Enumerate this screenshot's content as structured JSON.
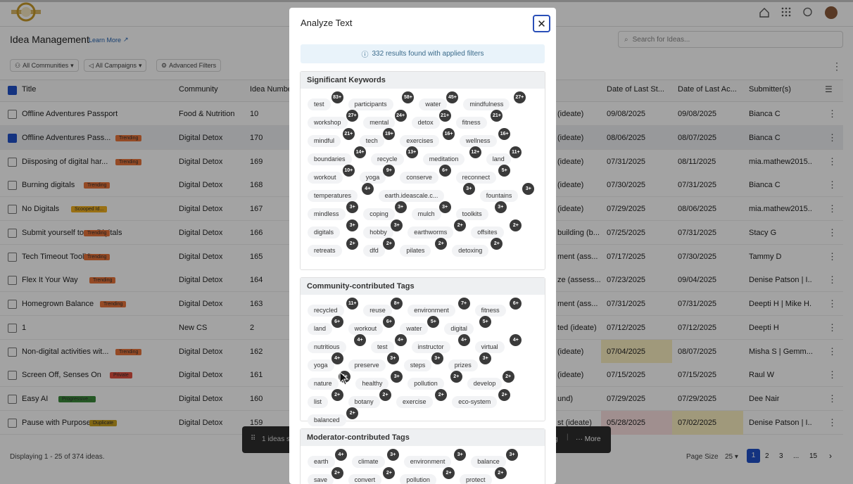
{
  "app": {
    "page_title": "Idea Management",
    "learn_more": "Learn More",
    "search_placeholder": "Search for Ideas..."
  },
  "filters": {
    "communities": "All Communities",
    "campaigns": "All Campaigns",
    "advanced": "Advanced Filters"
  },
  "columns": [
    "Title",
    "Community",
    "Idea Number",
    "Date of Last St...",
    "Date of Last Ac...",
    "Submitter(s)"
  ],
  "rows": [
    {
      "title": "Offline Adventures Passport",
      "community": "Food & Nutrition",
      "num": "10",
      "stage": "(ideate)",
      "d1": "09/08/2025",
      "d2": "09/08/2025",
      "sub": "Bianca C",
      "badge": "",
      "checked": false
    },
    {
      "title": "Offline Adventures Pass...",
      "community": "Digital Detox",
      "num": "170",
      "stage": "(ideate)",
      "d1": "08/06/2025",
      "d2": "08/07/2025",
      "sub": "Bianca C",
      "badge": "Trending",
      "checked": true
    },
    {
      "title": "Diisposing of digital har...",
      "community": "Digital Detox",
      "num": "169",
      "stage": "(ideate)",
      "d1": "07/31/2025",
      "d2": "08/11/2025",
      "sub": "mia.mathew2015...",
      "badge": "Trending",
      "checked": false
    },
    {
      "title": "Burning digitals",
      "community": "Digital Detox",
      "num": "168",
      "stage": "(ideate)",
      "d1": "07/30/2025",
      "d2": "07/31/2025",
      "sub": "Bianca C",
      "badge": "Trending",
      "checked": false
    },
    {
      "title": "No Digitals",
      "community": "Digital Detox",
      "num": "167",
      "stage": "(ideate)",
      "d1": "07/29/2025",
      "d2": "08/06/2025",
      "sub": "mia.mathew2015...",
      "badge": "Scooped Id...",
      "checked": false
    },
    {
      "title": "Submit yourself to no Digitals",
      "community": "Digital Detox",
      "num": "166",
      "stage": "building (b...",
      "d1": "07/25/2025",
      "d2": "07/31/2025",
      "sub": "Stacy G",
      "badge": "Trending",
      "checked": false
    },
    {
      "title": "Tech Timeout Toolkits",
      "community": "Digital Detox",
      "num": "165",
      "stage": "ment (ass...",
      "d1": "07/17/2025",
      "d2": "07/30/2025",
      "sub": "Tammy D",
      "badge": "Trending",
      "checked": false
    },
    {
      "title": "Flex It Your Way",
      "community": "Digital Detox",
      "num": "164",
      "stage": "ze (assess...",
      "d1": "07/23/2025",
      "d2": "09/04/2025",
      "sub": "Denise Patson | I...",
      "badge": "Trending",
      "checked": false
    },
    {
      "title": "Homegrown Balance",
      "community": "Digital Detox",
      "num": "163",
      "stage": "ment (ass...",
      "d1": "07/31/2025",
      "d2": "07/31/2025",
      "sub": "Deepti H | Mike H...",
      "badge": "Trending",
      "checked": false
    },
    {
      "title": "1",
      "community": "New CS",
      "num": "2",
      "stage": "ted (ideate)",
      "d1": "07/12/2025",
      "d2": "07/12/2025",
      "sub": "Deepti H",
      "badge": "",
      "checked": false
    },
    {
      "title": "Non-digital activities wit...",
      "community": "Digital Detox",
      "num": "162",
      "stage": "(ideate)",
      "d1": "07/04/2025",
      "d2": "08/07/2025",
      "sub": "Misha S | Gemm...",
      "badge": "Trending",
      "checked": false
    },
    {
      "title": "Screen Off, Senses On",
      "community": "Digital Detox",
      "num": "161",
      "stage": "(ideate)",
      "d1": "07/15/2025",
      "d2": "07/15/2025",
      "sub": "Raul W",
      "badge": "Private",
      "checked": false
    },
    {
      "title": "Easy AI",
      "community": "Digital Detox",
      "num": "160",
      "stage": "und)",
      "d1": "07/29/2025",
      "d2": "07/29/2025",
      "sub": "Dee Nair",
      "badge": "Progressive...",
      "checked": false
    },
    {
      "title": "Pause with Purpose",
      "community": "Digital Detox",
      "num": "159",
      "stage": "st (ideate)",
      "d1": "05/28/2025",
      "d2": "07/02/2025",
      "sub": "Denise Patson | I...",
      "badge": "Duplicate",
      "checked": false
    }
  ],
  "footer": {
    "displaying": "Displaying 1 - 25 of 374 ideas.",
    "page_size_label": "Page Size",
    "page_size": "25",
    "pages": [
      "1",
      "2",
      "3",
      "...",
      "15"
    ]
  },
  "toast": {
    "selected": "1 ideas s",
    "more": "More",
    "partial": "g"
  },
  "modal": {
    "title": "Analyze Text",
    "results": "332 results found with applied filters",
    "sections": [
      {
        "title": "Significant Keywords",
        "tags": [
          [
            "test",
            "83+"
          ],
          [
            "participants",
            "58+"
          ],
          [
            "water",
            "45+"
          ],
          [
            "mindfulness",
            "27+"
          ],
          [
            "workshop",
            "27+"
          ],
          [
            "mental",
            "24+"
          ],
          [
            "detox",
            "21+"
          ],
          [
            "fitness",
            "21+"
          ],
          [
            "mindful",
            "21+"
          ],
          [
            "tech",
            "19+"
          ],
          [
            "exercises",
            "16+"
          ],
          [
            "wellness",
            "16+"
          ],
          [
            "boundaries",
            "14+"
          ],
          [
            "recycle",
            "13+"
          ],
          [
            "meditation",
            "12+"
          ],
          [
            "land",
            "11+"
          ],
          [
            "workout",
            "10+"
          ],
          [
            "yoga",
            "9+"
          ],
          [
            "conserve",
            "6+"
          ],
          [
            "reconnect",
            "5+"
          ],
          [
            "temperatures",
            "4+"
          ],
          [
            "earth.ideascale.c...",
            "3+"
          ],
          [
            "fountains",
            "3+"
          ],
          [
            "mindless",
            "3+"
          ],
          [
            "coping",
            "3+"
          ],
          [
            "mulch",
            "3+"
          ],
          [
            "toolkits",
            "3+"
          ],
          [
            "digitals",
            "3+"
          ],
          [
            "hobby",
            "3+"
          ],
          [
            "earthworms",
            "2+"
          ],
          [
            "offsites",
            "2+"
          ],
          [
            "retreats",
            "2+"
          ],
          [
            "dfd",
            "2+"
          ],
          [
            "pilates",
            "2+"
          ],
          [
            "detoxing",
            "2+"
          ]
        ]
      },
      {
        "title": "Community-contributed Tags",
        "tags": [
          [
            "recycled",
            "11+"
          ],
          [
            "reuse",
            "8+"
          ],
          [
            "environment",
            "7+"
          ],
          [
            "fitness",
            "6+"
          ],
          [
            "land",
            "6+"
          ],
          [
            "workout",
            "6+"
          ],
          [
            "water",
            "5+"
          ],
          [
            "digital",
            "5+"
          ],
          [
            "nutritious",
            "4+"
          ],
          [
            "test",
            "4+"
          ],
          [
            "instructor",
            "4+"
          ],
          [
            "virtual",
            "4+"
          ],
          [
            "yoga",
            "4+"
          ],
          [
            "preserve",
            "3+"
          ],
          [
            "steps",
            "3+"
          ],
          [
            "prizes",
            "3+"
          ],
          [
            "nature",
            "3+"
          ],
          [
            "healthy",
            "3+"
          ],
          [
            "pollution",
            "2+"
          ],
          [
            "develop",
            "2+"
          ],
          [
            "list",
            "2+"
          ],
          [
            "botany",
            "2+"
          ],
          [
            "exercise",
            "2+"
          ],
          [
            "eco-system",
            "2+"
          ],
          [
            "balanced",
            "2+"
          ]
        ]
      },
      {
        "title": "Moderator-contributed Tags",
        "tags": [
          [
            "earth",
            "4+"
          ],
          [
            "climate",
            "3+"
          ],
          [
            "environment",
            "3+"
          ],
          [
            "balance",
            "3+"
          ],
          [
            "save",
            "2+"
          ],
          [
            "convert",
            "2+"
          ],
          [
            "pollution",
            "2+"
          ],
          [
            "protect",
            "2+"
          ]
        ]
      }
    ]
  },
  "colors": {
    "primary": "#2050c8",
    "trending": "#e8743a",
    "private": "#e05040",
    "progressive": "#3a8a3a",
    "scooped": "#f0b020",
    "duplicate": "#c8a020",
    "highlight_yellow": "#fbefc0",
    "highlight_pink": "#fbe0e0"
  }
}
